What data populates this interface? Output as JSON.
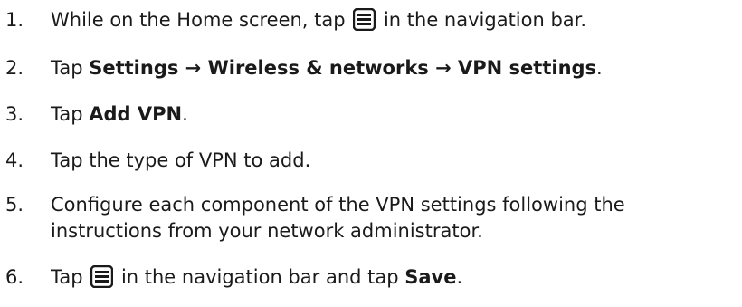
{
  "steps": [
    {
      "number": "1.",
      "before": "While on the Home screen, tap",
      "icon": "menu-icon",
      "after": "in the navigation bar."
    },
    {
      "number": "2.",
      "prefix": "Tap ",
      "settings": "Settings",
      "arrow1": " → ",
      "wireless": "Wireless & networks",
      "arrow2": " → ",
      "vpn": "VPN settings",
      "suffix": "."
    },
    {
      "number": "3.",
      "prefix": "Tap ",
      "bold": "Add VPN",
      "suffix": "."
    },
    {
      "number": "4.",
      "text": "Tap the type of VPN to add."
    },
    {
      "number": "5.",
      "line1": "Configure each component of the VPN settings following the",
      "line2": "instructions from your network administrator."
    },
    {
      "number": "6.",
      "before": "Tap",
      "icon": "menu-icon",
      "middle": "in the navigation bar and tap ",
      "bold": "Save",
      "suffix": "."
    }
  ],
  "colors": {
    "text": "#1a1a1a",
    "icon": "#1a1a1a"
  }
}
